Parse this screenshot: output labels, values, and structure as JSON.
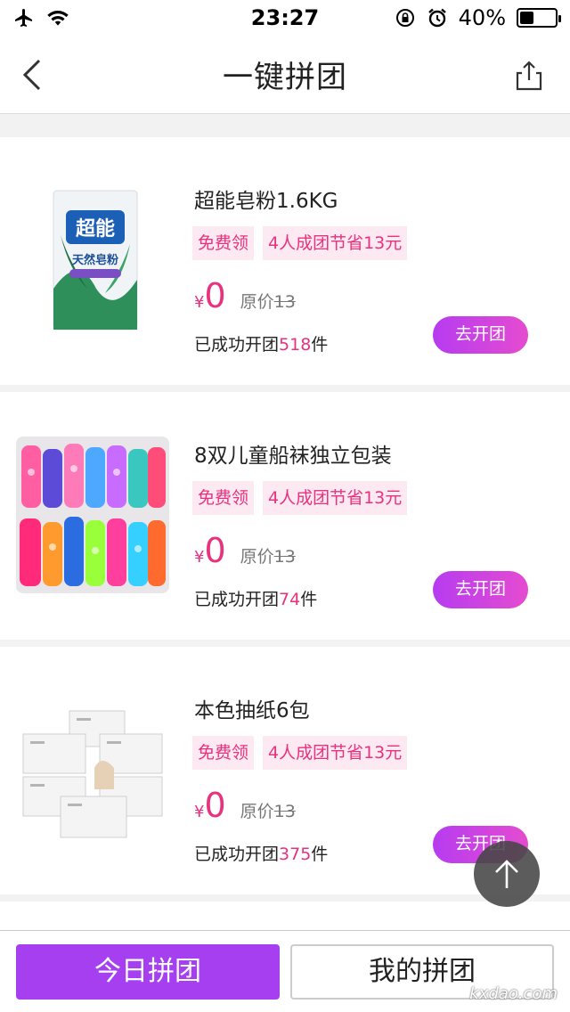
{
  "status_bar": {
    "time": "23:27",
    "battery": "40%",
    "battery_level": 0.4
  },
  "nav": {
    "title": "一键拼团"
  },
  "products": [
    {
      "title": "超能皂粉1.6KG",
      "tag_free": "免费领",
      "tag_group": "4人成团节省13元",
      "currency": "¥",
      "price": "0",
      "orig_label": "原价",
      "orig_price": "13",
      "sold_prefix": "已成功开团",
      "sold_count": "518",
      "sold_suffix": "件",
      "button": "去开团",
      "image_text": {
        "brand": "超能",
        "sub": "天然皂粉"
      }
    },
    {
      "title": "8双儿童船袜独立包装",
      "tag_free": "免费领",
      "tag_group": "4人成团节省13元",
      "currency": "¥",
      "price": "0",
      "orig_label": "原价",
      "orig_price": "13",
      "sold_prefix": "已成功开团",
      "sold_count": "74",
      "sold_suffix": "件",
      "button": "去开团"
    },
    {
      "title": "本色抽纸6包",
      "tag_free": "免费领",
      "tag_group": "4人成团节省13元",
      "currency": "¥",
      "price": "0",
      "orig_label": "原价",
      "orig_price": "13",
      "sold_prefix": "已成功开团",
      "sold_count": "375",
      "sold_suffix": "件",
      "button": "去开团"
    }
  ],
  "bottom": {
    "today": "今日拼团",
    "mine": "我的拼团"
  },
  "watermark": "kxdao.com",
  "colors": {
    "accent": "#e8327e",
    "purple": "#a63ff0",
    "tag_bg": "#fde9f2"
  },
  "icons": [
    "airplane-icon",
    "wifi-icon",
    "rotation-lock-icon",
    "alarm-icon",
    "battery-icon",
    "back-icon",
    "share-icon",
    "arrow-up-icon"
  ]
}
